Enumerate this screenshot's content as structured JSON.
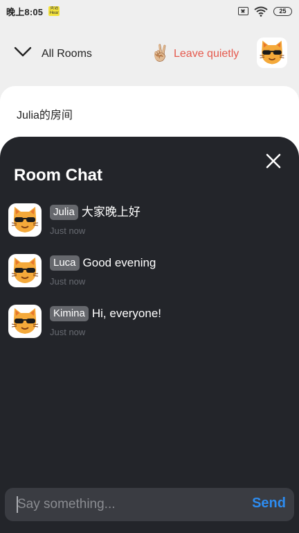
{
  "status_bar": {
    "time": "晚上8:05",
    "badge_text": "英语 Hear",
    "battery": "25"
  },
  "header": {
    "all_rooms_label": "All Rooms",
    "leave_emoji": "✌🏼",
    "leave_label": "Leave quietly"
  },
  "room": {
    "title": "Julia的房间"
  },
  "chat": {
    "title": "Room Chat",
    "messages": [
      {
        "name": "Julia",
        "text": "大家晚上好",
        "time": "Just now"
      },
      {
        "name": "Luca",
        "text": "Good evening",
        "time": "Just now"
      },
      {
        "name": "Kimina",
        "text": "Hi, everyone!",
        "time": "Just now"
      }
    ],
    "input_placeholder": "Say something...",
    "send_label": "Send"
  },
  "colors": {
    "leave_accent": "#e55a4e",
    "send_accent": "#2d8cf0",
    "panel_bg": "#23252a",
    "avatar_fur": "#f4a93a"
  },
  "icons": [
    "chevron-down-icon",
    "peace-hand-icon",
    "cat-sunglasses-avatar",
    "close-icon",
    "sim-icon",
    "wifi-icon"
  ]
}
